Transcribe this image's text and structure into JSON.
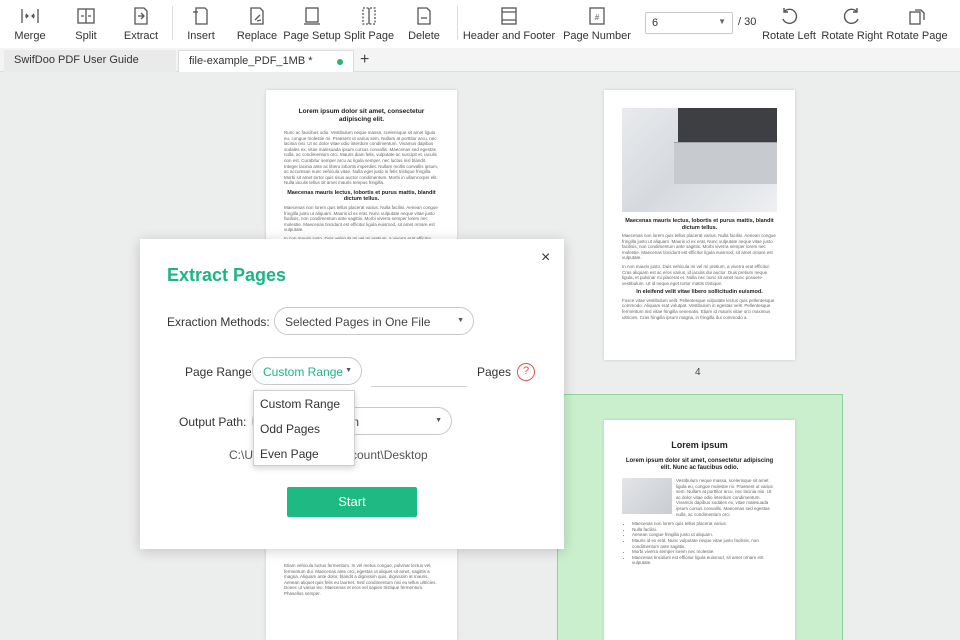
{
  "toolbar": {
    "buttons": [
      {
        "label": "Merge",
        "icon": "merge-icon"
      },
      {
        "label": "Split",
        "icon": "split-icon"
      },
      {
        "label": "Extract",
        "icon": "extract-icon"
      },
      {
        "label": "Insert",
        "icon": "insert-icon"
      },
      {
        "label": "Replace",
        "icon": "replace-icon"
      },
      {
        "label": "Page Setup",
        "icon": "page-setup-icon"
      },
      {
        "label": "Split Page",
        "icon": "split-page-icon"
      },
      {
        "label": "Delete",
        "icon": "delete-icon"
      },
      {
        "label": "Header and Footer",
        "icon": "header-footer-icon"
      },
      {
        "label": "Page Number",
        "icon": "page-number-icon"
      },
      {
        "label": "Rotate Left",
        "icon": "rotate-left-icon"
      },
      {
        "label": "Rotate Right",
        "icon": "rotate-right-icon"
      },
      {
        "label": "Rotate Page",
        "icon": "rotate-page-icon"
      }
    ],
    "current_page": "6",
    "total_pages": "/ 30"
  },
  "tabs": [
    {
      "label": "SwifDoo PDF User Guide"
    },
    {
      "label": "file-example_PDF_1MB *"
    }
  ],
  "pages": {
    "left_top": {
      "heading1": "Lorem ipsum dolor sit amet, consectetur adipiscing elit.",
      "para1": "Nunc ac faucibus odio. Vestibulum neque massa, scelerisque sit amet ligula eu, congue molestie mi. Praesent ut varius sem. Nullam at porttitor arcu, nec lacinia nisi. Ut ac dolor vitae odio interdum condimentum. Vivamus dapibus sodales ex, vitae malesuada ipsum cursus convallis. Maecenas sed egestas nulla, ac condimentum orci. Mauris diam felis, vulputate ac suscipit et, iaculis non est. Curabitur semper arcu ac ligula semper, nec luctus nisl blandit. Integer lacinia ante ac libero lobortis imperdiet. Nullam mollis convallis ipsum, ac accumsan nunc vehicula vitae. Nulla eget justo in felis tristique fringilla. Morbi sit amet tortor quis risus auctor condimentum. Morbi in ullamcorper elit. Nulla iaculis tellus sit amet mauris tempus fringilla.",
      "heading2": "Maecenas mauris lectus, lobortis et purus mattis, blandit dictum tellus.",
      "para2": "Maecenas non lorem quis tellus placerat varius. Nulla facilisi. Aenean congue fringilla justo ut aliquam. Mauris id ex erat. Nunc vulputate neque vitae justo facilisis, non condimentum ante sagittis. Morbi viverra semper lorem nec molestie. Maecenas tincidunt est efficitur ligula euismod, sit amet ornare est vulputate.",
      "para3": "In non mauris justo. Duis vehicula mi vel mi pretium, a viverra erat efficitur. Cras aliquam est ac eros varius, id iaculis dui auctor. Duis pretium neque ligula, et pulvinar mi placerat et. Nulla nec nunc sit amet nunc posuere vestibulum. Ut id neque eget tortor mattis tristique. Donec ante est, blandit sit amet tristique vel, lacinia pulvinar arcu. Pellentesque scelerisque fermentum erat, id posuere justo pulvinar ut."
    },
    "left_bottom": {
      "para": "Etiam vehicula luctus fermentum. In vel metus congue, pulvinar lectus vel, fermentum dui. Maecenas ante orci, egestas ut aliquet sit amet, sagittis a magna. Aliquam ante dolor, blandit a dignissim quis, dignissim at mauris. Aenean aliquet quis felis eu laoreet. Sed condimentum nisi eu tellus ultricies. Donec ut varius leo. Maecenas et eros vel sapien tristique fermentum. Phasellus semper."
    },
    "right_top": {
      "image": "laptop-photo",
      "heading1": "Maecenas mauris lectus, lobortis et purus mattis, blandit dictum tellus.",
      "para1": "Maecenas non lorem quis tellus placerat varius. Nulla facilisi. Aenean congue fringilla justo ut aliquam. Mauris id ex erat. Nunc vulputate neque vitae justo facilisis, non condimentum ante sagittis. Morbi viverra semper lorem nec molestie. Maecenas tincidunt est efficitur ligula euismod, sit amet ornare est vulputate.",
      "para2": "In non mauris justo. Duis vehicula mi vel mi pretium, a viverra erat efficitur. Cras aliquam est ac eros varius, id iaculis dui auctor. Duis pretium neque ligula, et pulvinar mi placerat et. Nulla nec nunc sit amet nunc posuere vestibulum. Ut id neque eget tortor mattis tristique.",
      "heading2": "In eleifend velit vitae libero sollicitudin euismod.",
      "para3": "Fusce vitae vestibulum velit. Pellentesque vulputate lectus quis pellentesque commodo. Aliquam erat volutpat. Vestibulum in egestas velit. Pellentesque fermentum nisl vitae fringilla venenatis. Etiam id mauris vitae orci maximus ultricies. Cras fringilla ipsum magna, in fringilla dui commodo a."
    },
    "right_top_number": "4",
    "right_bottom": {
      "title": "Lorem ipsum",
      "subtitle": "Lorem ipsum dolor sit amet, consectetur adipiscing elit. Nunc ac faucibus odio.",
      "para": "Vestibulum neque massa, scelerisque sit amet ligula eu, congue molestie mi. Praesent ut varius sem. Nullam at porttitor arcu, nec lacinia nisi. Ut ac dolor vitae odio interdum condimentum. Vivamus dapibus sodales ex, vitae malesuada ipsum cursus convallis. Maecenas sed egestas nulla, ac condimentum orci.",
      "list": [
        "Maecenas non lorem quis tellus placerat varius.",
        "Nulla facilisi.",
        "Aenean congue fringilla justo ut aliquam.",
        "Mauris id ex erat. Nunc vulputate neque vitae justo facilisis, non condimentum ante sagittis.",
        "Morbi viverra semper lorem nec molestie.",
        "Maecenas tincidunt est efficitur ligula euismod, sit amet ornare est vulputate."
      ]
    }
  },
  "dialog": {
    "title": "Extract Pages",
    "method_label": "Exraction Methods:",
    "method_value": "Selected Pages in One File",
    "range_label": "Page Range",
    "range_value": "Custom Range",
    "pages_label": "Pages",
    "help_glyph": "?",
    "output_label": "Output Path:",
    "output_value": "ation",
    "path_left": "C:\\U",
    "path_right": "ccount\\Desktop",
    "start_label": "Start",
    "close_glyph": "×"
  },
  "dropdown": {
    "options": [
      "Custom Range",
      "Odd Pages",
      "Even Page"
    ]
  },
  "colors": {
    "accent": "#1db584",
    "selection": "#c9efcd",
    "help": "#e05555"
  }
}
